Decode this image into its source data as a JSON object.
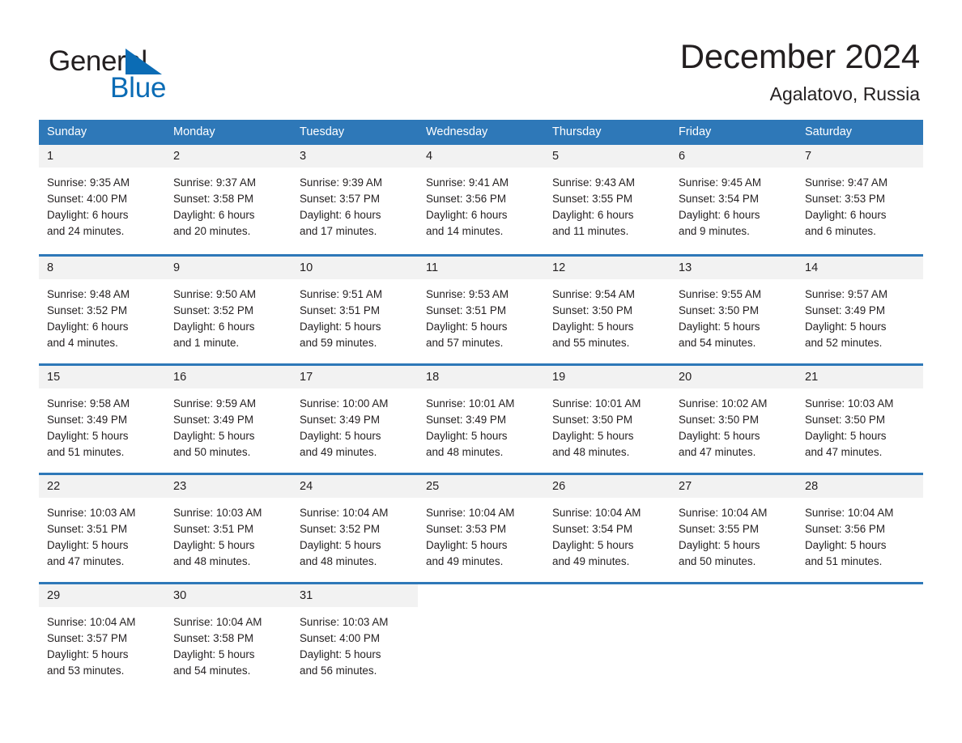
{
  "brand": {
    "name_part1": "General",
    "name_part2": "Blue",
    "triangle_color": "#0b6cb5",
    "logo_icon": "triangle-logo-icon"
  },
  "header": {
    "title": "December 2024",
    "subtitle": "Agalatovo, Russia"
  },
  "theme": {
    "header_blue": "#2e78b8",
    "daynum_band": "#f2f2f2",
    "text": "#231f20",
    "brand_blue": "#0b6cb5"
  },
  "calendar": {
    "weekdays": [
      "Sunday",
      "Monday",
      "Tuesday",
      "Wednesday",
      "Thursday",
      "Friday",
      "Saturday"
    ],
    "weeks": [
      [
        {
          "day": "1",
          "sunrise": "Sunrise: 9:35 AM",
          "sunset": "Sunset: 4:00 PM",
          "daylight1": "Daylight: 6 hours",
          "daylight2": "and 24 minutes."
        },
        {
          "day": "2",
          "sunrise": "Sunrise: 9:37 AM",
          "sunset": "Sunset: 3:58 PM",
          "daylight1": "Daylight: 6 hours",
          "daylight2": "and 20 minutes."
        },
        {
          "day": "3",
          "sunrise": "Sunrise: 9:39 AM",
          "sunset": "Sunset: 3:57 PM",
          "daylight1": "Daylight: 6 hours",
          "daylight2": "and 17 minutes."
        },
        {
          "day": "4",
          "sunrise": "Sunrise: 9:41 AM",
          "sunset": "Sunset: 3:56 PM",
          "daylight1": "Daylight: 6 hours",
          "daylight2": "and 14 minutes."
        },
        {
          "day": "5",
          "sunrise": "Sunrise: 9:43 AM",
          "sunset": "Sunset: 3:55 PM",
          "daylight1": "Daylight: 6 hours",
          "daylight2": "and 11 minutes."
        },
        {
          "day": "6",
          "sunrise": "Sunrise: 9:45 AM",
          "sunset": "Sunset: 3:54 PM",
          "daylight1": "Daylight: 6 hours",
          "daylight2": "and 9 minutes."
        },
        {
          "day": "7",
          "sunrise": "Sunrise: 9:47 AM",
          "sunset": "Sunset: 3:53 PM",
          "daylight1": "Daylight: 6 hours",
          "daylight2": "and 6 minutes."
        }
      ],
      [
        {
          "day": "8",
          "sunrise": "Sunrise: 9:48 AM",
          "sunset": "Sunset: 3:52 PM",
          "daylight1": "Daylight: 6 hours",
          "daylight2": "and 4 minutes."
        },
        {
          "day": "9",
          "sunrise": "Sunrise: 9:50 AM",
          "sunset": "Sunset: 3:52 PM",
          "daylight1": "Daylight: 6 hours",
          "daylight2": "and 1 minute."
        },
        {
          "day": "10",
          "sunrise": "Sunrise: 9:51 AM",
          "sunset": "Sunset: 3:51 PM",
          "daylight1": "Daylight: 5 hours",
          "daylight2": "and 59 minutes."
        },
        {
          "day": "11",
          "sunrise": "Sunrise: 9:53 AM",
          "sunset": "Sunset: 3:51 PM",
          "daylight1": "Daylight: 5 hours",
          "daylight2": "and 57 minutes."
        },
        {
          "day": "12",
          "sunrise": "Sunrise: 9:54 AM",
          "sunset": "Sunset: 3:50 PM",
          "daylight1": "Daylight: 5 hours",
          "daylight2": "and 55 minutes."
        },
        {
          "day": "13",
          "sunrise": "Sunrise: 9:55 AM",
          "sunset": "Sunset: 3:50 PM",
          "daylight1": "Daylight: 5 hours",
          "daylight2": "and 54 minutes."
        },
        {
          "day": "14",
          "sunrise": "Sunrise: 9:57 AM",
          "sunset": "Sunset: 3:49 PM",
          "daylight1": "Daylight: 5 hours",
          "daylight2": "and 52 minutes."
        }
      ],
      [
        {
          "day": "15",
          "sunrise": "Sunrise: 9:58 AM",
          "sunset": "Sunset: 3:49 PM",
          "daylight1": "Daylight: 5 hours",
          "daylight2": "and 51 minutes."
        },
        {
          "day": "16",
          "sunrise": "Sunrise: 9:59 AM",
          "sunset": "Sunset: 3:49 PM",
          "daylight1": "Daylight: 5 hours",
          "daylight2": "and 50 minutes."
        },
        {
          "day": "17",
          "sunrise": "Sunrise: 10:00 AM",
          "sunset": "Sunset: 3:49 PM",
          "daylight1": "Daylight: 5 hours",
          "daylight2": "and 49 minutes."
        },
        {
          "day": "18",
          "sunrise": "Sunrise: 10:01 AM",
          "sunset": "Sunset: 3:49 PM",
          "daylight1": "Daylight: 5 hours",
          "daylight2": "and 48 minutes."
        },
        {
          "day": "19",
          "sunrise": "Sunrise: 10:01 AM",
          "sunset": "Sunset: 3:50 PM",
          "daylight1": "Daylight: 5 hours",
          "daylight2": "and 48 minutes."
        },
        {
          "day": "20",
          "sunrise": "Sunrise: 10:02 AM",
          "sunset": "Sunset: 3:50 PM",
          "daylight1": "Daylight: 5 hours",
          "daylight2": "and 47 minutes."
        },
        {
          "day": "21",
          "sunrise": "Sunrise: 10:03 AM",
          "sunset": "Sunset: 3:50 PM",
          "daylight1": "Daylight: 5 hours",
          "daylight2": "and 47 minutes."
        }
      ],
      [
        {
          "day": "22",
          "sunrise": "Sunrise: 10:03 AM",
          "sunset": "Sunset: 3:51 PM",
          "daylight1": "Daylight: 5 hours",
          "daylight2": "and 47 minutes."
        },
        {
          "day": "23",
          "sunrise": "Sunrise: 10:03 AM",
          "sunset": "Sunset: 3:51 PM",
          "daylight1": "Daylight: 5 hours",
          "daylight2": "and 48 minutes."
        },
        {
          "day": "24",
          "sunrise": "Sunrise: 10:04 AM",
          "sunset": "Sunset: 3:52 PM",
          "daylight1": "Daylight: 5 hours",
          "daylight2": "and 48 minutes."
        },
        {
          "day": "25",
          "sunrise": "Sunrise: 10:04 AM",
          "sunset": "Sunset: 3:53 PM",
          "daylight1": "Daylight: 5 hours",
          "daylight2": "and 49 minutes."
        },
        {
          "day": "26",
          "sunrise": "Sunrise: 10:04 AM",
          "sunset": "Sunset: 3:54 PM",
          "daylight1": "Daylight: 5 hours",
          "daylight2": "and 49 minutes."
        },
        {
          "day": "27",
          "sunrise": "Sunrise: 10:04 AM",
          "sunset": "Sunset: 3:55 PM",
          "daylight1": "Daylight: 5 hours",
          "daylight2": "and 50 minutes."
        },
        {
          "day": "28",
          "sunrise": "Sunrise: 10:04 AM",
          "sunset": "Sunset: 3:56 PM",
          "daylight1": "Daylight: 5 hours",
          "daylight2": "and 51 minutes."
        }
      ],
      [
        {
          "day": "29",
          "sunrise": "Sunrise: 10:04 AM",
          "sunset": "Sunset: 3:57 PM",
          "daylight1": "Daylight: 5 hours",
          "daylight2": "and 53 minutes."
        },
        {
          "day": "30",
          "sunrise": "Sunrise: 10:04 AM",
          "sunset": "Sunset: 3:58 PM",
          "daylight1": "Daylight: 5 hours",
          "daylight2": "and 54 minutes."
        },
        {
          "day": "31",
          "sunrise": "Sunrise: 10:03 AM",
          "sunset": "Sunset: 4:00 PM",
          "daylight1": "Daylight: 5 hours",
          "daylight2": "and 56 minutes."
        },
        {
          "day": "",
          "sunrise": "",
          "sunset": "",
          "daylight1": "",
          "daylight2": ""
        },
        {
          "day": "",
          "sunrise": "",
          "sunset": "",
          "daylight1": "",
          "daylight2": ""
        },
        {
          "day": "",
          "sunrise": "",
          "sunset": "",
          "daylight1": "",
          "daylight2": ""
        },
        {
          "day": "",
          "sunrise": "",
          "sunset": "",
          "daylight1": "",
          "daylight2": ""
        }
      ]
    ]
  }
}
